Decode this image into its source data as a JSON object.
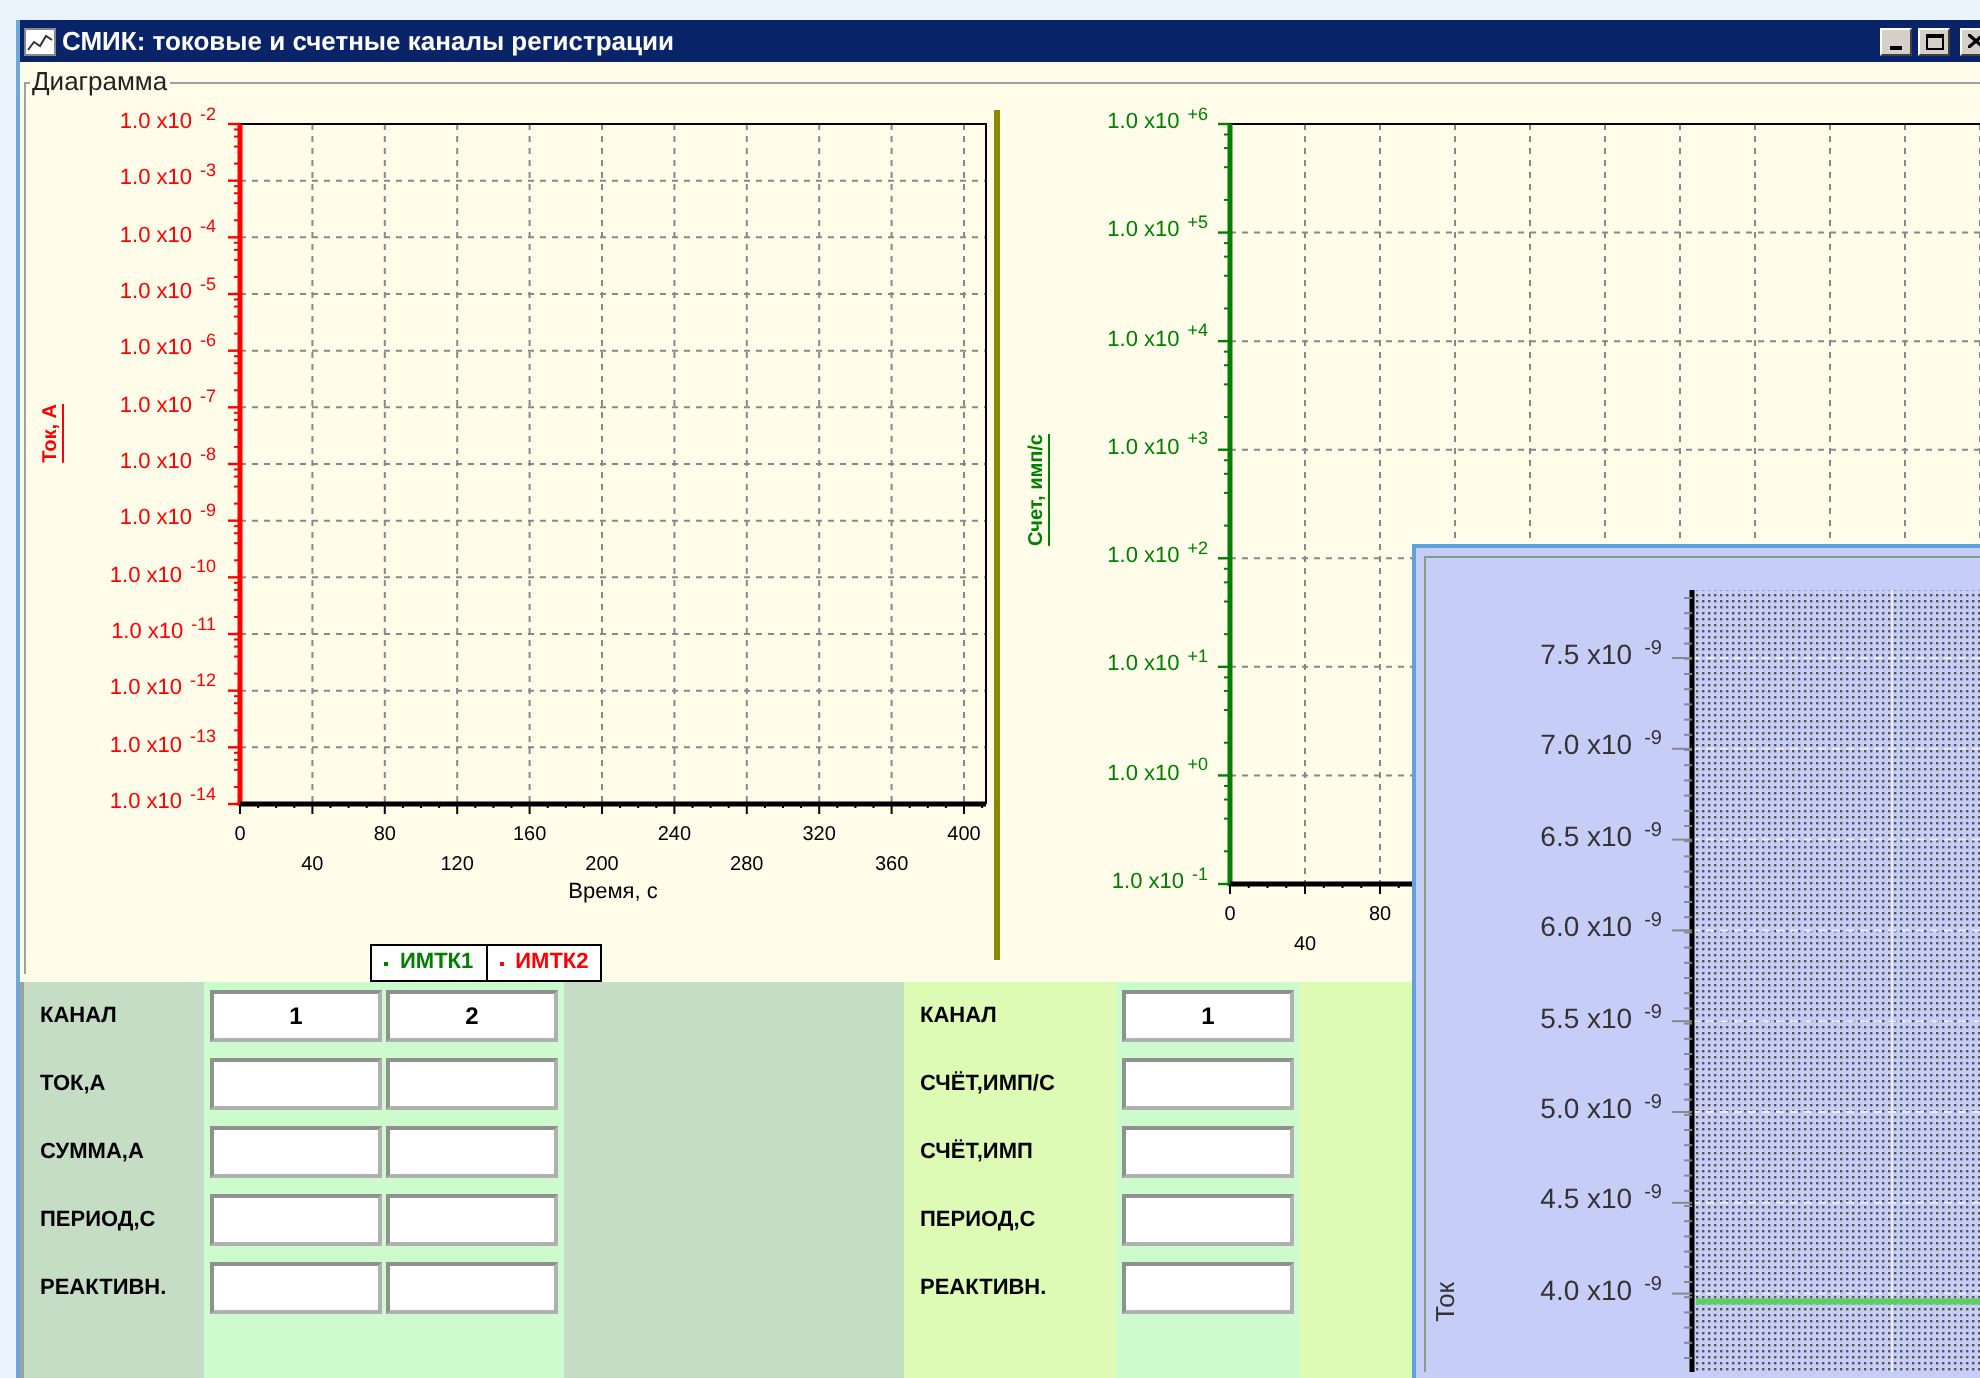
{
  "window": {
    "title": "СМИК: токовые и счетные каналы регистрации"
  },
  "diagram": {
    "title": "Диаграмма",
    "current_chart": {
      "x_title": "Время, с",
      "y_title": "Ток, А",
      "x_labels": [
        "0",
        "40",
        "80",
        "120",
        "160",
        "200",
        "240",
        "280",
        "320",
        "360",
        "400"
      ],
      "y_labels": [
        "1.0 x10$^{-2}$",
        "1.0 x10$^{-3}$",
        "1.0 x10$^{-4}$",
        "1.0 x10$^{-5}$",
        "1.0 x10$^{-6}$",
        "1.0 x10$^{-7}$",
        "1.0 x10$^{-8}$",
        "1.0 x10$^{-9}$",
        "1.0 x10$^{-10}$",
        "1.0 x10$^{-11}$",
        "1.0 x10$^{-12}$",
        "1.0 x10$^{-13}$",
        "1.0 x10$^{-14}$"
      ]
    },
    "count_chart": {
      "y_title": "Счет, имп/с",
      "x_labels": [
        "0",
        "40",
        "80"
      ],
      "y_labels": [
        "1.0 x10$^{+6}$",
        "1.0 x10$^{+5}$",
        "1.0 x10$^{+4}$",
        "1.0 x10$^{+3}$",
        "1.0 x10$^{+2}$",
        "1.0 x10$^{+1}$",
        "1.0 x10$^{+0}$",
        "1.0 x10$^{-1}$"
      ]
    },
    "legend": [
      {
        "label": "ИМТК1",
        "color": "#008000"
      },
      {
        "label": "ИМТК2",
        "color": "#ff0000"
      }
    ]
  },
  "current_table": {
    "header": "КАНАЛ",
    "channels": [
      "1",
      "2"
    ],
    "rows": [
      "ТОК,А",
      "СУММА,А",
      "ПЕРИОД,С",
      "РЕАКТИВН."
    ]
  },
  "count_table": {
    "header": "КАНАЛ",
    "channels": [
      "1"
    ],
    "rows": [
      "СЧЁТ,ИМП/С",
      "СЧЁТ,ИМП",
      "ПЕРИОД,С",
      "РЕАКТИВН."
    ]
  },
  "popup_chart": {
    "y_title": "Ток",
    "y_labels": [
      "7.5 x10$^{-9}$",
      "7.0 x10$^{-9}$",
      "6.5 x10$^{-9}$",
      "6.0 x10$^{-9}$",
      "5.5 x10$^{-9}$",
      "5.0 x10$^{-9}$",
      "4.5 x10$^{-9}$",
      "4.0 x10$^{-9}$"
    ]
  }
}
